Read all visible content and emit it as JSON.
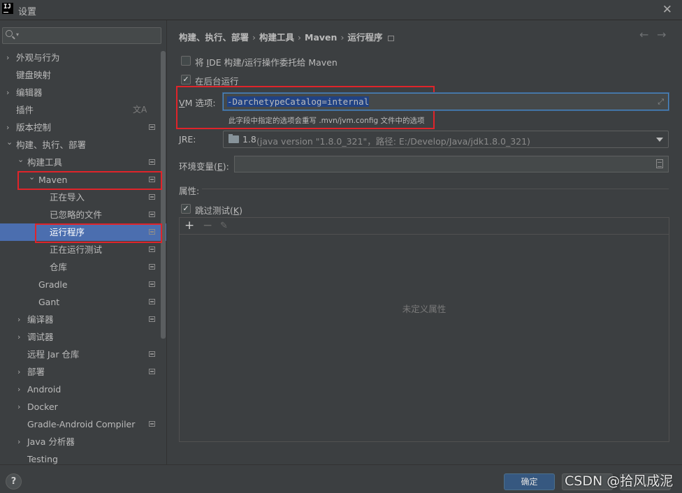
{
  "window": {
    "title": "设置"
  },
  "search": {
    "placeholder": ""
  },
  "sidebar": {
    "items": [
      {
        "label": "外观与行为",
        "expandable": true,
        "expanded": false,
        "level": 0
      },
      {
        "label": "键盘映射",
        "expandable": false,
        "level": 0
      },
      {
        "label": "编辑器",
        "expandable": true,
        "expanded": false,
        "level": 0
      },
      {
        "label": "插件",
        "expandable": false,
        "level": 0,
        "icon": "translate-icon"
      },
      {
        "label": "版本控制",
        "expandable": true,
        "expanded": false,
        "level": 0,
        "icon": "project-icon"
      },
      {
        "label": "构建、执行、部署",
        "expandable": true,
        "expanded": true,
        "level": 0
      },
      {
        "label": "构建工具",
        "expandable": true,
        "expanded": true,
        "level": 1,
        "icon": "project-icon"
      },
      {
        "label": "Maven",
        "expandable": true,
        "expanded": true,
        "level": 2,
        "icon": "project-icon"
      },
      {
        "label": "正在导入",
        "expandable": false,
        "level": 3,
        "icon": "project-icon"
      },
      {
        "label": "已忽略的文件",
        "expandable": false,
        "level": 3,
        "icon": "project-icon"
      },
      {
        "label": "运行程序",
        "expandable": false,
        "level": 3,
        "icon": "project-icon",
        "selected": true
      },
      {
        "label": "正在运行测试",
        "expandable": false,
        "level": 3,
        "icon": "project-icon"
      },
      {
        "label": "仓库",
        "expandable": false,
        "level": 3,
        "icon": "project-icon"
      },
      {
        "label": "Gradle",
        "expandable": false,
        "level": 2,
        "icon": "project-icon"
      },
      {
        "label": "Gant",
        "expandable": false,
        "level": 2,
        "icon": "project-icon"
      },
      {
        "label": "编译器",
        "expandable": true,
        "expanded": false,
        "level": 1,
        "icon": "project-icon"
      },
      {
        "label": "调试器",
        "expandable": true,
        "expanded": false,
        "level": 1
      },
      {
        "label": "远程 Jar 仓库",
        "expandable": false,
        "level": 1,
        "icon": "project-icon"
      },
      {
        "label": "部署",
        "expandable": true,
        "expanded": false,
        "level": 1,
        "icon": "project-icon"
      },
      {
        "label": "Android",
        "expandable": true,
        "expanded": false,
        "level": 1
      },
      {
        "label": "Docker",
        "expandable": true,
        "expanded": false,
        "level": 1
      },
      {
        "label": "Gradle-Android Compiler",
        "expandable": false,
        "level": 1,
        "icon": "project-icon"
      },
      {
        "label": "Java 分析器",
        "expandable": true,
        "expanded": false,
        "level": 1
      },
      {
        "label": "Testing",
        "expandable": false,
        "level": 1
      }
    ]
  },
  "breadcrumb": {
    "items": [
      "构建、执行、部署",
      "构建工具",
      "Maven",
      "运行程序"
    ],
    "separator": "›"
  },
  "form": {
    "delegate": {
      "label_pre": "将 ",
      "label_mn": "I",
      "label_post": "DE 构建/运行操作委托给 Maven",
      "checked": false
    },
    "background": {
      "label": "在后台运行",
      "checked": true
    },
    "vm_options": {
      "label_mn": "V",
      "label_post": "M 选项:",
      "value": "-DarchetypeCatalog=internal",
      "hint": "此字段中指定的选项会重写 .mvn/jvm.config 文件中的选项"
    },
    "jre": {
      "label_mn": "J",
      "label_post": "RE:",
      "version": "1.8",
      "detail": "(java version \"1.8.0_321\"，路径: E:/Develop/Java/jdk1.8.0_321)"
    },
    "env": {
      "label_pre": "环境变量(",
      "label_mn": "E",
      "label_post": "):",
      "value": ""
    },
    "properties": {
      "label": "属性:",
      "skip_tests": {
        "label_pre": "跳过测试(",
        "label_mn": "K",
        "label_post": ")",
        "checked": true
      },
      "toolbar": {
        "add": "+",
        "remove": "−",
        "edit": "✎"
      },
      "empty_text": "未定义属性"
    }
  },
  "buttons": {
    "help": "?",
    "ok": "确定"
  },
  "watermark": "CSDN @拾风成泥",
  "colors": {
    "selection": "#4b6eaf",
    "highlight_box": "#e0242a",
    "ok_button": "#365880"
  }
}
